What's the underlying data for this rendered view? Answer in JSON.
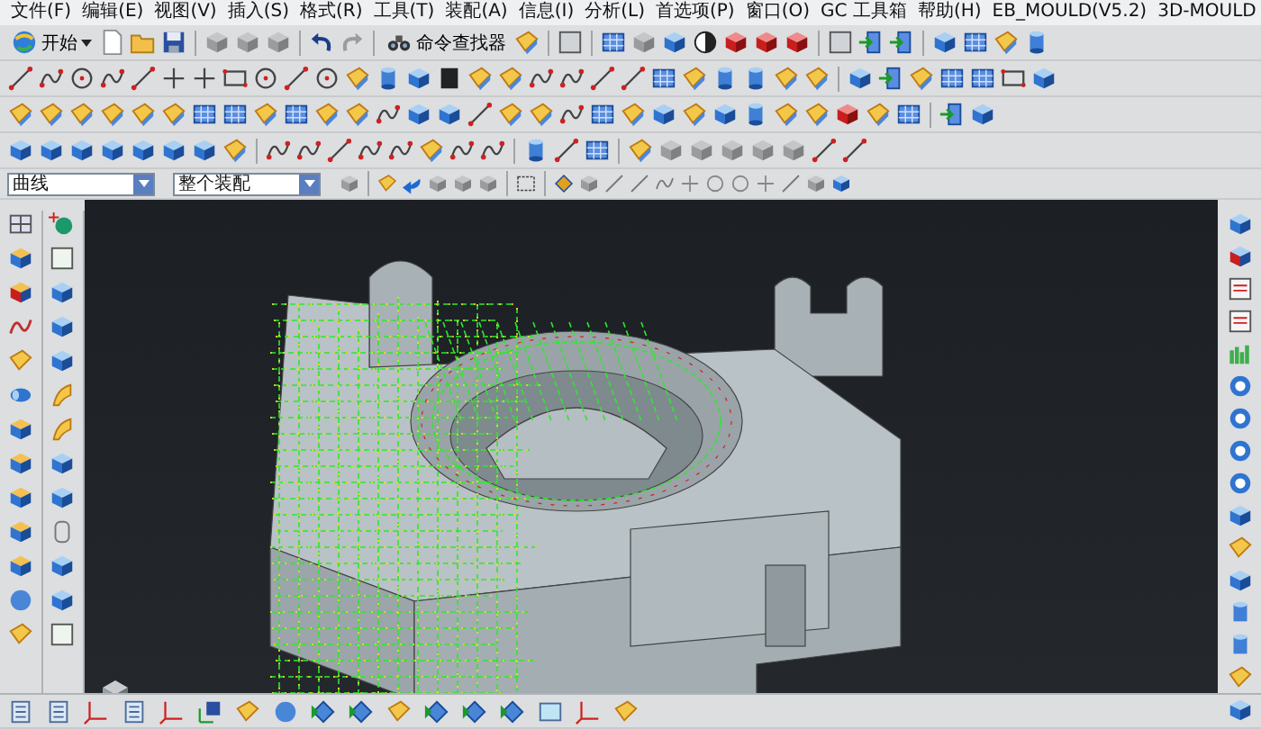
{
  "menu_bar": {
    "items": [
      "文件(F)",
      "编辑(E)",
      "视图(V)",
      "插入(S)",
      "格式(R)",
      "工具(T)",
      "装配(A)",
      "信息(I)",
      "分析(L)",
      "首选项(P)",
      "窗口(O)",
      "GC 工具箱",
      "帮助(H)",
      "EB_MOULD(V5.2)",
      "3D-MOULD"
    ]
  },
  "toolbar": {
    "start_button": "开始",
    "command_finder": "命令查找器"
  },
  "selection_bar": {
    "filter": "曲线",
    "scope": "整个装配"
  }
}
